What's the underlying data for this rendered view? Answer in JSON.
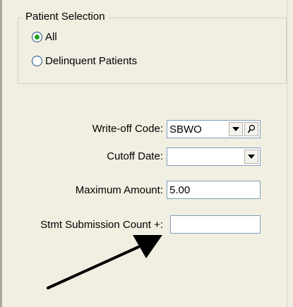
{
  "patient_selection": {
    "title": "Patient Selection",
    "options": [
      {
        "label": "All",
        "selected": true
      },
      {
        "label": "Delinquent Patients",
        "selected": false
      }
    ]
  },
  "form": {
    "writeoff_code": {
      "label": "Write-off Code:",
      "value": "SBWO"
    },
    "cutoff_date": {
      "label": "Cutoff Date:",
      "value": ""
    },
    "maximum_amount": {
      "label": "Maximum Amount:",
      "value": "5.00"
    },
    "stmt_submission_count": {
      "label": "Stmt Submission Count +:",
      "value": ""
    }
  },
  "icons": {
    "dropdown": "chevron-down-icon",
    "lookup": "magnifier-icon",
    "annotation": "arrow-icon"
  },
  "colors": {
    "panel_bg": "#f1efe2",
    "field_border": "#7f9db9",
    "radio_selected_dot": "#21a121"
  }
}
